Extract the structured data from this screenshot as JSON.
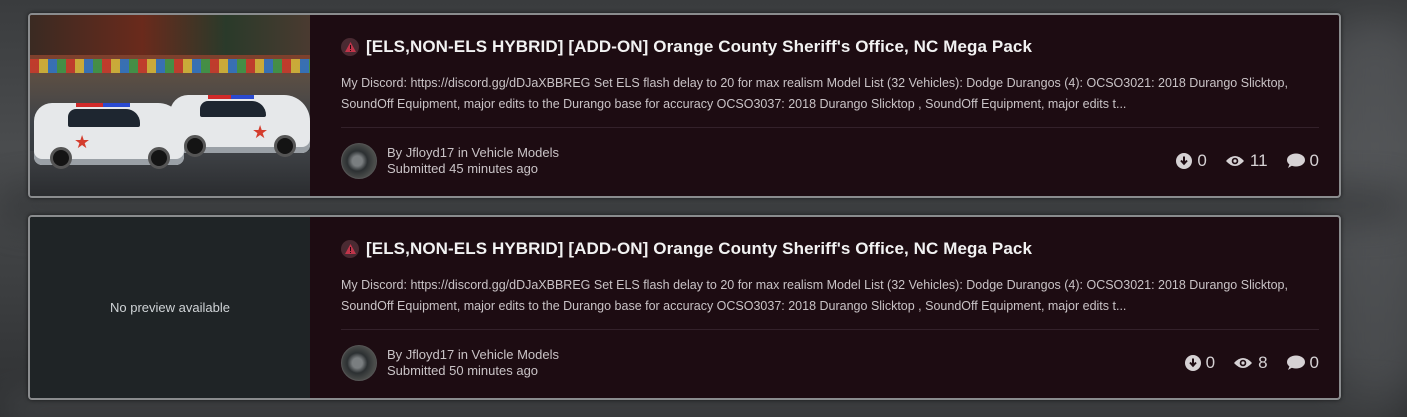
{
  "colors": {
    "card_bg": "#1d0c12",
    "card_border": "#8a8c8e",
    "title": "#f2f2f2",
    "text": "#c9c3c6",
    "warning_icon": "#c0354a"
  },
  "items": [
    {
      "title": "[ELS,NON-ELS HYBRID] [ADD-ON] Orange County Sheriff's Office, NC Mega Pack",
      "description": "My Discord: https://discord.gg/dDJaXBBREG  Set ELS flash delay to 20 for max realism Model List (32 Vehicles):   Dodge Durangos (4):    OCSO3021: 2018 Durango Slicktop, SoundOff Equipment, major edits to the Durango base for accuracy OCSO3037: 2018 Durango Slicktop , SoundOff Equipment, major edits t...",
      "author_line": "By Jfloyd17 in Vehicle Models",
      "submitted": "Submitted 45 minutes ago",
      "downloads": "0",
      "views": "11",
      "comments": "0",
      "thumbnail": "photo"
    },
    {
      "title": "[ELS,NON-ELS HYBRID] [ADD-ON] Orange County Sheriff's Office, NC Mega Pack",
      "description": "My Discord: https://discord.gg/dDJaXBBREG  Set ELS flash delay to 20 for max realism Model List (32 Vehicles):   Dodge Durangos (4):    OCSO3021: 2018 Durango Slicktop, SoundOff Equipment, major edits to the Durango base for accuracy OCSO3037: 2018 Durango Slicktop , SoundOff Equipment, major edits t...",
      "author_line": "By Jfloyd17 in Vehicle Models",
      "submitted": "Submitted 50 minutes ago",
      "downloads": "0",
      "views": "8",
      "comments": "0",
      "thumbnail": "none",
      "no_preview_text": "No preview available"
    }
  ],
  "icons": {
    "warning": "warning-triangle-icon",
    "downloads": "download-circle-icon",
    "views": "eye-icon",
    "comments": "comment-bubble-icon"
  }
}
